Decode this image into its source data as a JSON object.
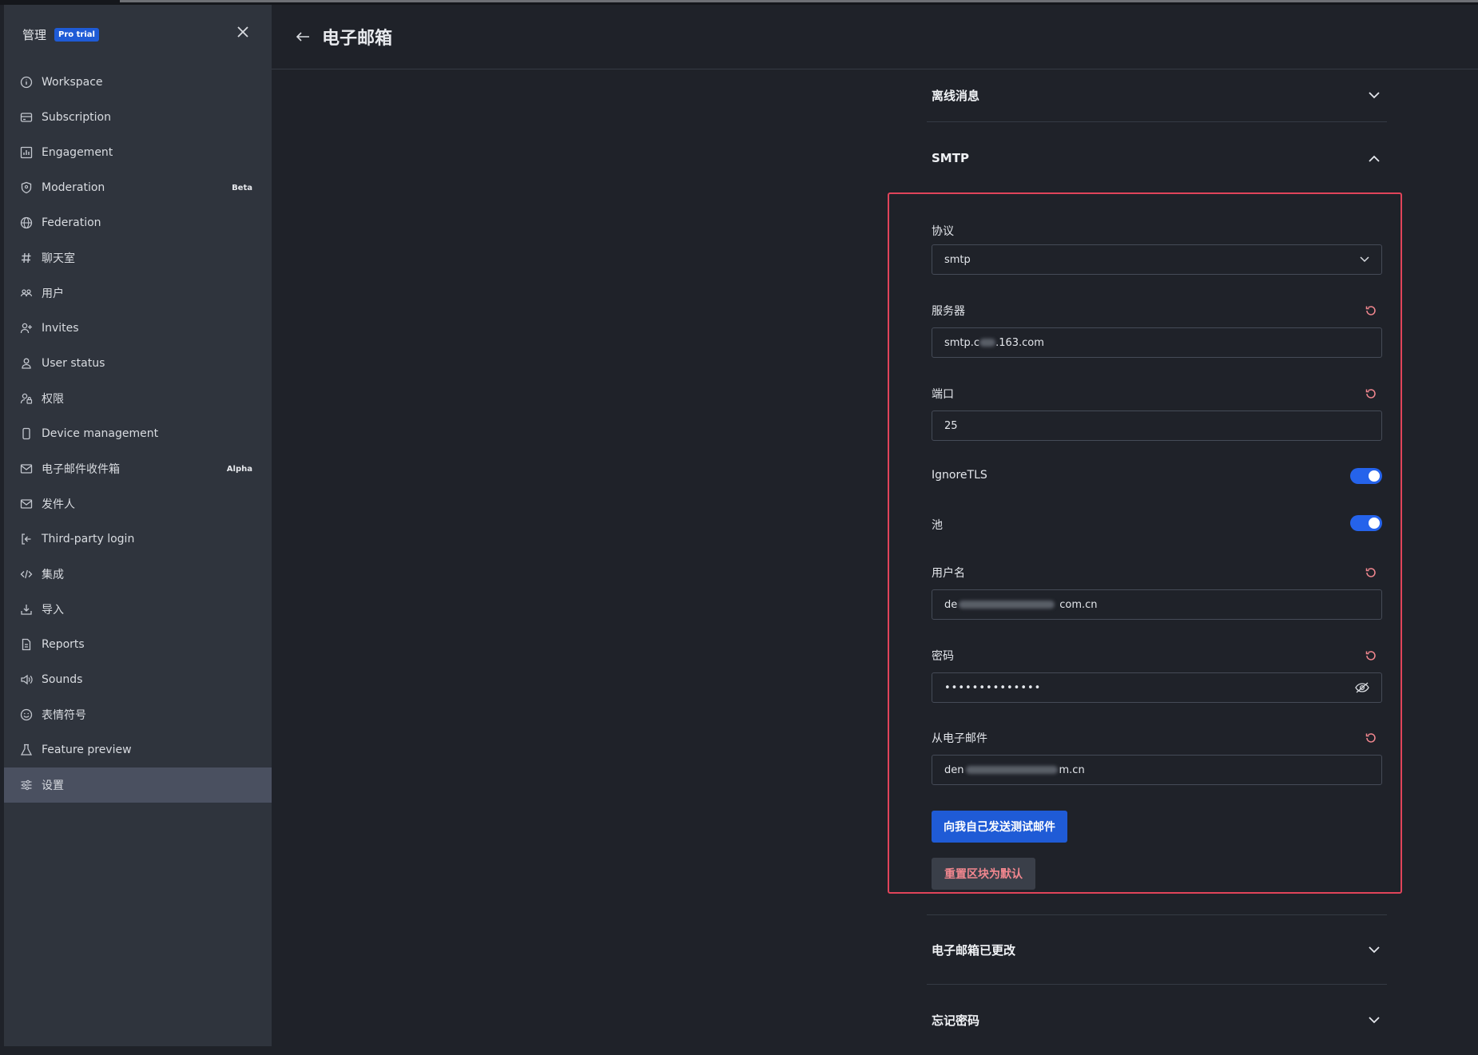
{
  "sidebar": {
    "title": "管理",
    "badge": "Pro trial",
    "items": [
      {
        "label": "Workspace",
        "icon": "info-icon"
      },
      {
        "label": "Subscription",
        "icon": "card-icon"
      },
      {
        "label": "Engagement",
        "icon": "chart-icon"
      },
      {
        "label": "Moderation",
        "icon": "shield-icon",
        "tag": "Beta"
      },
      {
        "label": "Federation",
        "icon": "globe-icon"
      },
      {
        "label": "聊天室",
        "icon": "hash-icon"
      },
      {
        "label": "用户",
        "icon": "team-icon"
      },
      {
        "label": "Invites",
        "icon": "user-add-icon"
      },
      {
        "label": "User status",
        "icon": "user-icon"
      },
      {
        "label": "权限",
        "icon": "user-lock-icon"
      },
      {
        "label": "Device management",
        "icon": "phone-icon"
      },
      {
        "label": "电子邮件收件箱",
        "icon": "mail-icon",
        "tag": "Alpha"
      },
      {
        "label": "发件人",
        "icon": "mail-send-icon"
      },
      {
        "label": "Third-party login",
        "icon": "login-icon"
      },
      {
        "label": "集成",
        "icon": "code-icon"
      },
      {
        "label": "导入",
        "icon": "import-icon"
      },
      {
        "label": "Reports",
        "icon": "file-icon"
      },
      {
        "label": "Sounds",
        "icon": "sound-icon"
      },
      {
        "label": "表情符号",
        "icon": "emoji-icon"
      },
      {
        "label": "Feature preview",
        "icon": "flask-icon"
      },
      {
        "label": "设置",
        "icon": "sliders-icon"
      }
    ]
  },
  "header": {
    "title": "电子邮箱"
  },
  "sections": {
    "offline": "离线消息",
    "smtp": "SMTP",
    "email_changed": "电子邮箱已更改",
    "forgot_password": "忘记密码"
  },
  "smtp": {
    "protocol_label": "协议",
    "protocol_value": "smtp",
    "server_label": "服务器",
    "server_prefix": "smtp.c",
    "server_suffix": ".163.com",
    "port_label": "端口",
    "port_value": "25",
    "ignore_tls_label": "IgnoreTLS",
    "ignore_tls": true,
    "pool_label": "池",
    "pool": true,
    "username_label": "用户名",
    "username_prefix": "de",
    "username_suffix": "com.cn",
    "password_label": "密码",
    "password_mask": "••••••••••••••",
    "from_email_label": "从电子邮件",
    "from_email_prefix": "den",
    "from_email_suffix": "m.cn",
    "test_button": "向我自己发送测试邮件",
    "reset_button": "重置区块为默认"
  },
  "colors": {
    "accent": "#1f5bd6",
    "highlight_border": "#e0445a",
    "reset_icon": "#f2878f"
  }
}
